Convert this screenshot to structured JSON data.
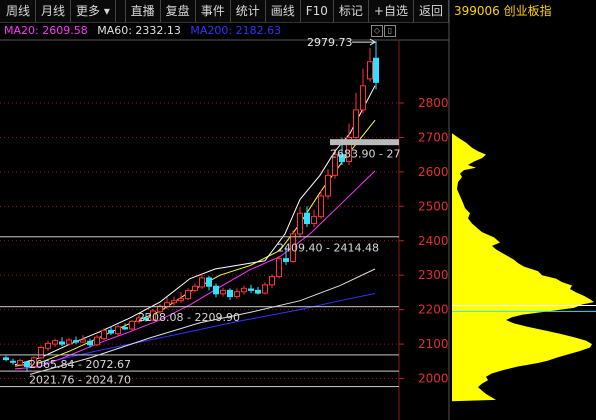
{
  "toolbar": {
    "items": [
      "周线",
      "月线",
      "更多 ▾",
      "直播",
      "复盘",
      "事件",
      "统计",
      "画线",
      "F10",
      "标记",
      "+自选",
      "返回"
    ]
  },
  "symbol_title": "399006 创业板指",
  "ma": {
    "ma20": {
      "label": "MA20: 2609.58",
      "color": "#ff33ff"
    },
    "ma60": {
      "label": "MA60: 2332.13",
      "color": "#e0e0e0"
    },
    "ma200": {
      "label": "MA200: 2182.63",
      "color": "#3333ff"
    }
  },
  "price_axis": {
    "ticks": [
      "2800",
      "2700",
      "2600",
      "2500",
      "2400",
      "2300",
      "2200",
      "2100",
      "2000"
    ],
    "ylim": [
      1934,
      2988
    ]
  },
  "annotations": {
    "high": "2979.73",
    "zone1": "2683.90 - 27",
    "zone2": "2409.40 - 2414.48",
    "zone3": "2208.08 - 2209.90",
    "zone4": "2065.84 - 2072.67",
    "zone5": "2021.76 - 2024.70"
  },
  "colors": {
    "up": "#ff3333",
    "down": "#33e0ff",
    "ma5": "#ffffff",
    "ma10": "#ffff33",
    "ma20": "#ff33ff",
    "ma60": "#e0e0e0",
    "ma200": "#3333ff",
    "profile": "#ffff00",
    "grid": "#8b1a1a"
  }
}
